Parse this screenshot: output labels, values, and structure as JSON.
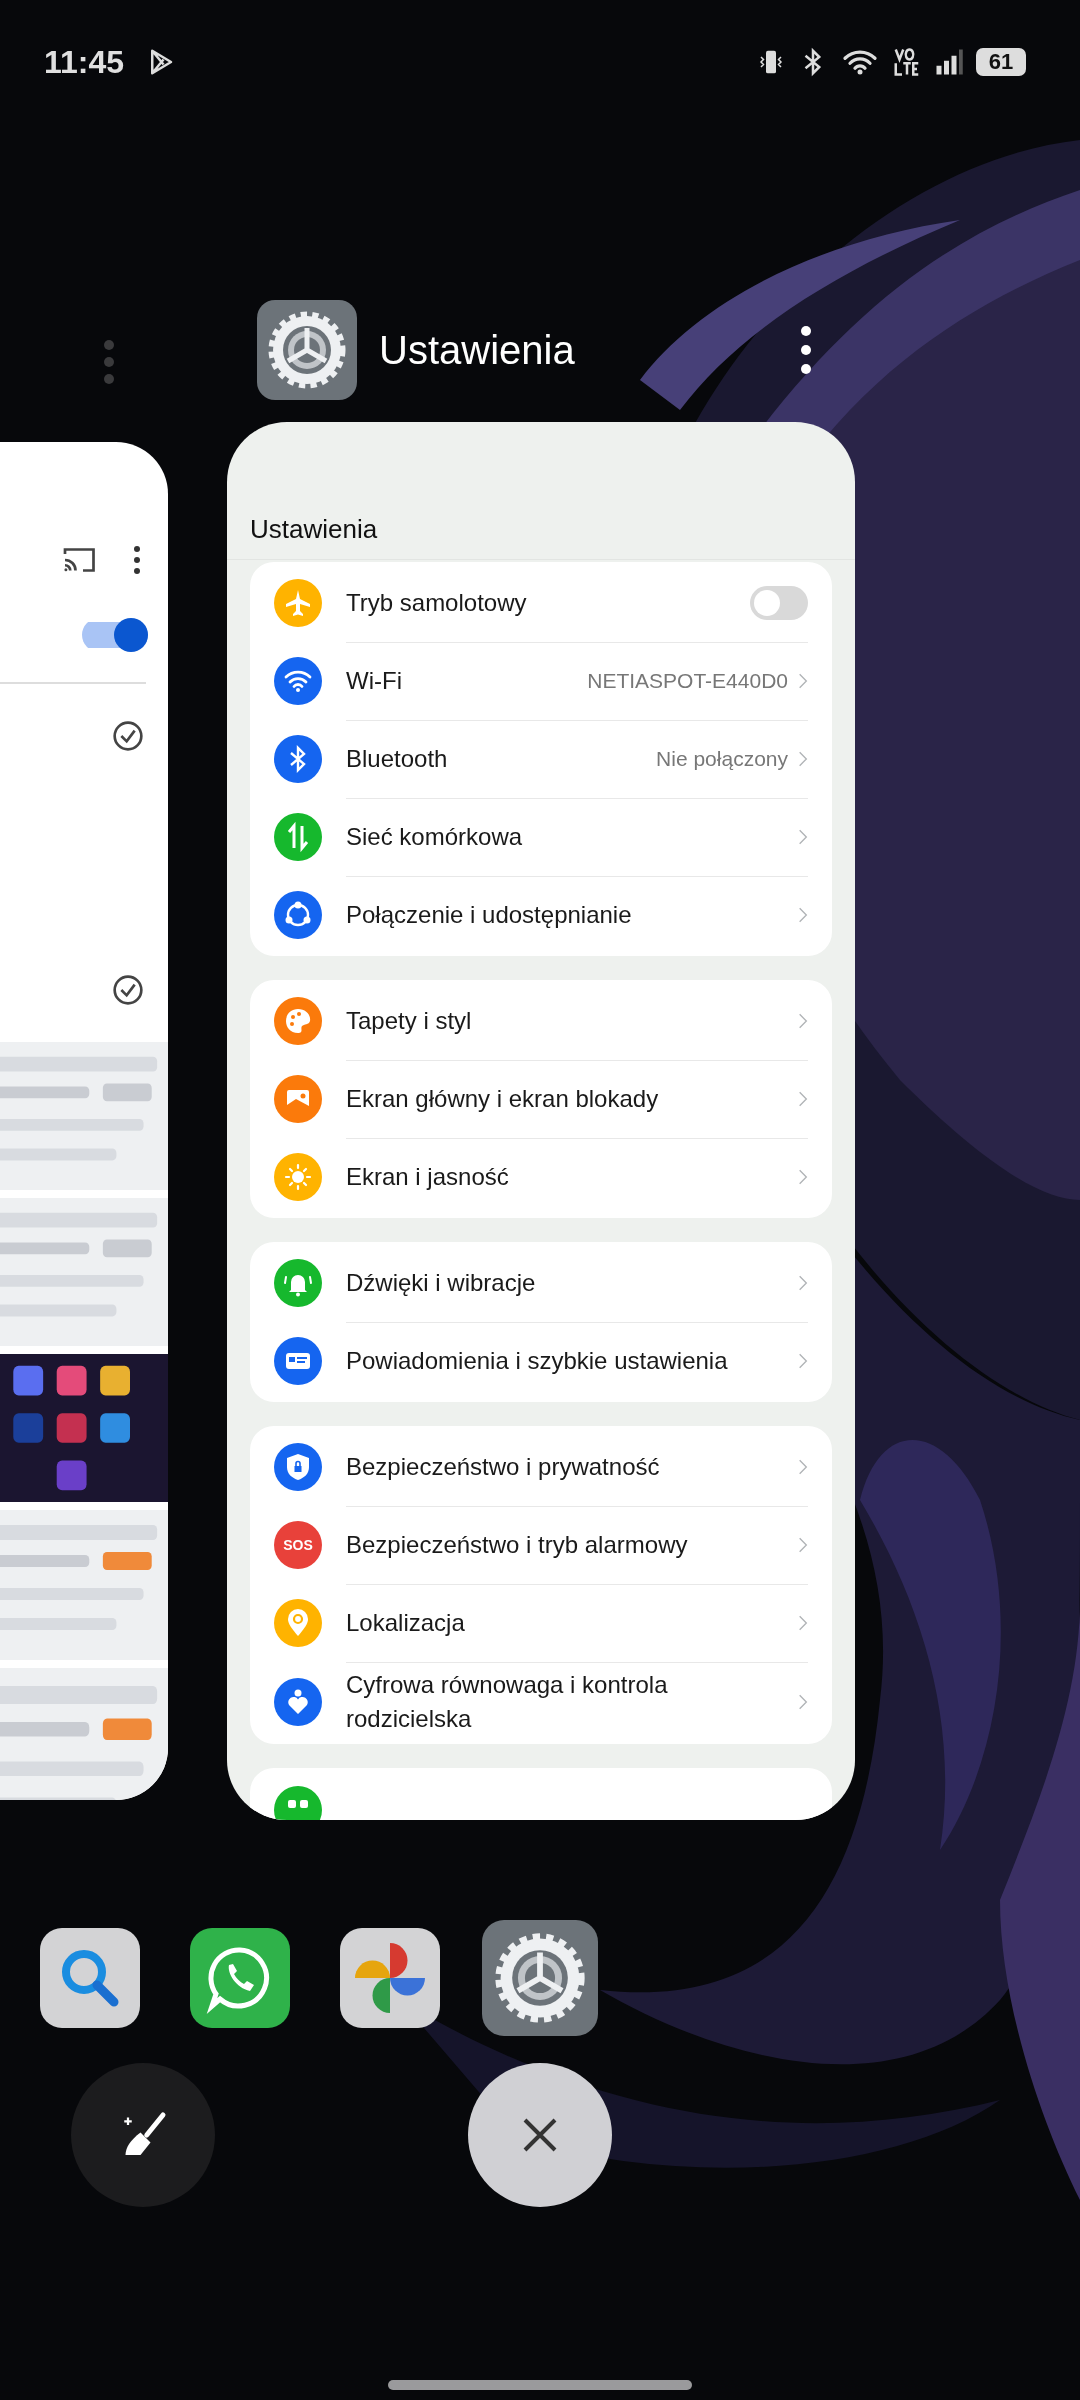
{
  "status_bar": {
    "time": "11:45",
    "battery": "61"
  },
  "prev_app": {
    "toggle": {
      "on": true
    }
  },
  "app_header": {
    "title": "Ustawienia"
  },
  "settings": {
    "title": "Ustawienia",
    "groups": [
      {
        "rows": [
          {
            "kind": "toggle",
            "label": "Tryb samolotowy",
            "color": "#ffb300",
            "on": false
          },
          {
            "kind": "link",
            "label": "Wi-Fi",
            "color": "#1565f0",
            "value": "NETIASPOT-E440D0"
          },
          {
            "kind": "link",
            "label": "Bluetooth",
            "color": "#1565f0",
            "value": "Nie połączony"
          },
          {
            "kind": "link",
            "label": "Sieć komórkowa",
            "color": "#16b82d"
          },
          {
            "kind": "link",
            "label": "Połączenie i udostępnianie",
            "color": "#1565f0"
          }
        ]
      },
      {
        "rows": [
          {
            "kind": "link",
            "label": "Tapety i styl",
            "color": "#fb7a0b"
          },
          {
            "kind": "link",
            "label": "Ekran główny i ekran blokady",
            "color": "#fb7a0b"
          },
          {
            "kind": "link",
            "label": "Ekran i jasność",
            "color": "#ffb300"
          }
        ]
      },
      {
        "rows": [
          {
            "kind": "link",
            "label": "Dźwięki i wibracje",
            "color": "#16b82d"
          },
          {
            "kind": "link",
            "label": "Powiadomienia i szybkie ustawienia",
            "color": "#1565f0"
          }
        ]
      },
      {
        "rows": [
          {
            "kind": "link",
            "label": "Bezpieczeństwo i prywatność",
            "color": "#1565f0"
          },
          {
            "kind": "link",
            "label": "Bezpieczeństwo i tryb alarmowy",
            "color": "#e8413a",
            "badge": "SOS"
          },
          {
            "kind": "link",
            "label": "Lokalizacja",
            "color": "#ffb300"
          },
          {
            "kind": "link",
            "label": "Cyfrowa równowaga i kontrola rodzicielska",
            "color": "#1565f0"
          }
        ]
      }
    ]
  },
  "dock": [
    {
      "kind": "search",
      "selected": false
    },
    {
      "kind": "chat",
      "selected": false
    },
    {
      "kind": "photos",
      "selected": false
    },
    {
      "kind": "settings",
      "selected": true
    }
  ]
}
